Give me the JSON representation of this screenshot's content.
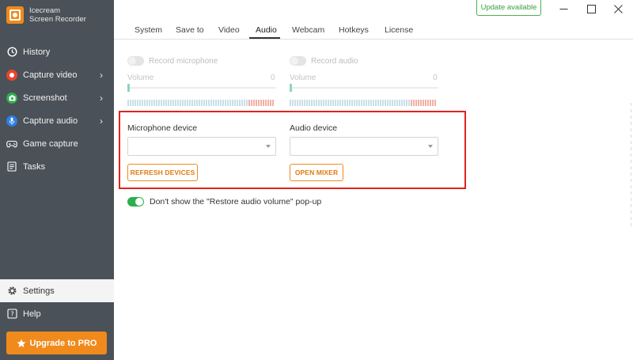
{
  "app": {
    "name_line1": "Icecream",
    "name_line2": "Screen Recorder"
  },
  "sidebar": {
    "items": [
      {
        "label": "History",
        "icon": "history-icon",
        "color": "#ffffff",
        "chevron": false
      },
      {
        "label": "Capture video",
        "icon": "record-icon",
        "color": "#e8452c",
        "chevron": true
      },
      {
        "label": "Screenshot",
        "icon": "camera-icon",
        "color": "#2eae4e",
        "chevron": true
      },
      {
        "label": "Capture audio",
        "icon": "microphone-icon",
        "color": "#2f7fe0",
        "chevron": true
      },
      {
        "label": "Game capture",
        "icon": "gamepad-icon",
        "color": "#ffffff",
        "chevron": false
      },
      {
        "label": "Tasks",
        "icon": "tasks-icon",
        "color": "#ffffff",
        "chevron": false
      }
    ],
    "bottom": [
      {
        "label": "Settings",
        "icon": "gear-icon",
        "active": true
      },
      {
        "label": "Help",
        "icon": "help-icon",
        "active": false
      }
    ],
    "upgrade_label": "Upgrade to PRO"
  },
  "window": {
    "update_label": "Update available"
  },
  "tabs": [
    "System",
    "Save to",
    "Video",
    "Audio",
    "Webcam",
    "Hotkeys",
    "License"
  ],
  "active_tab": "Audio",
  "audio": {
    "record_microphone": {
      "label": "Record microphone",
      "enabled": false
    },
    "record_audio": {
      "label": "Record audio",
      "enabled": false
    },
    "mic_volume": {
      "label": "Volume",
      "value": "0"
    },
    "audio_volume": {
      "label": "Volume",
      "value": "0"
    },
    "microphone_device": {
      "label": "Microphone device",
      "value": ""
    },
    "audio_device": {
      "label": "Audio device",
      "value": ""
    },
    "refresh_devices_label": "REFRESH DEVICES",
    "open_mixer_label": "OPEN MIXER",
    "restore_popup": {
      "label": "Don't show the \"Restore audio volume\" pop-up",
      "checked": true
    }
  },
  "colors": {
    "accent": "#f08a1c",
    "sidebar": "#4a5158",
    "green": "#2eae4e",
    "highlight": "#e0231f"
  }
}
